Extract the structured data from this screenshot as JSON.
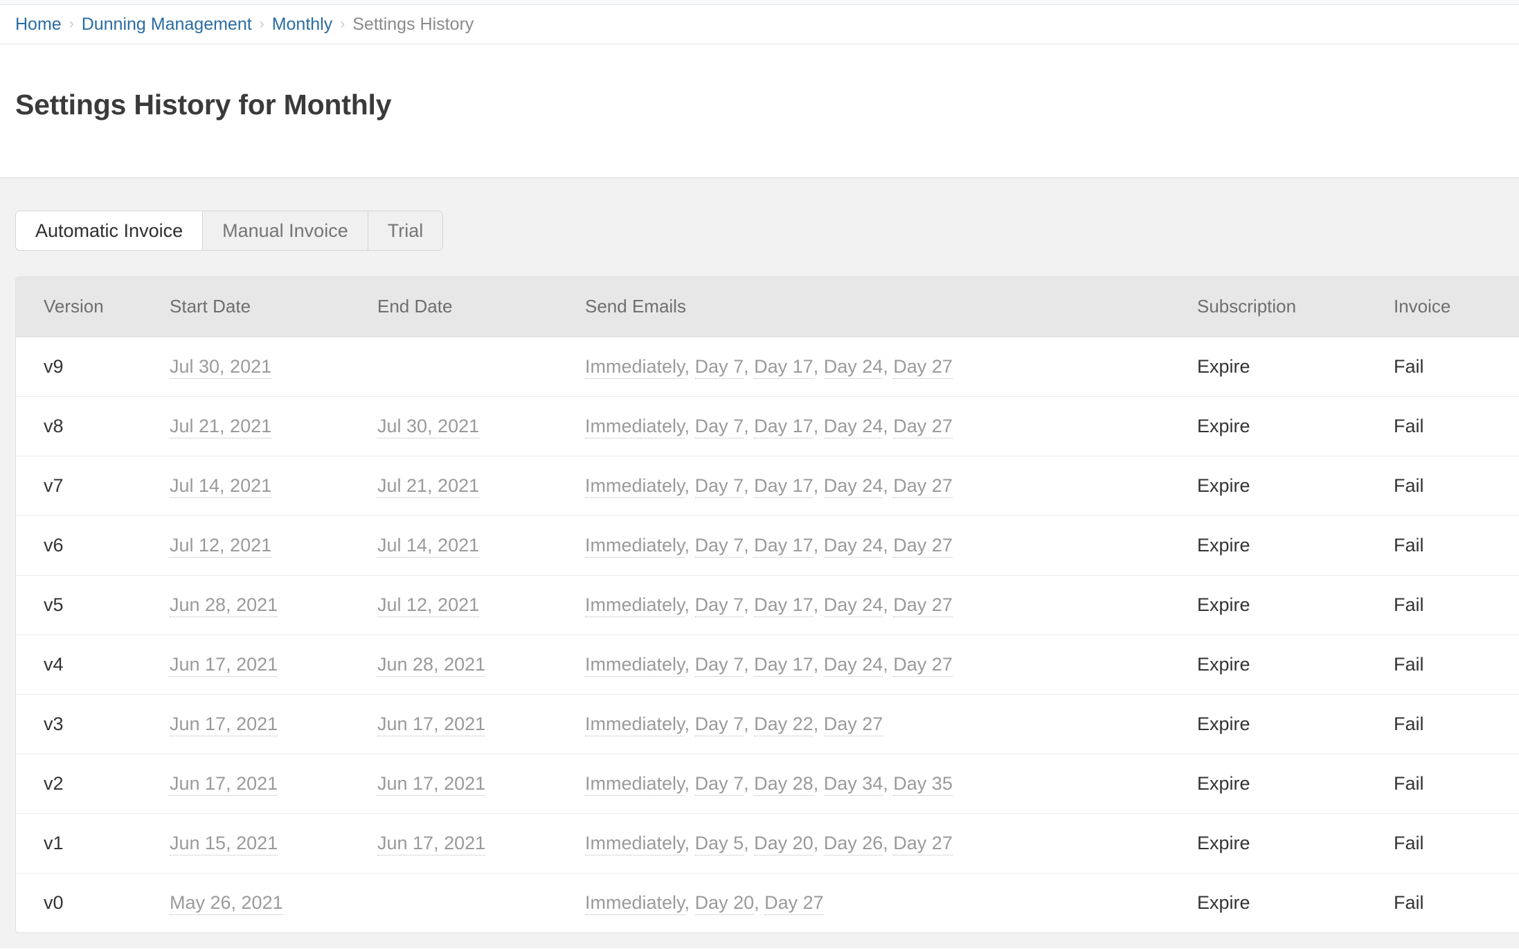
{
  "breadcrumb": {
    "separator": "›",
    "items": [
      {
        "label": "Home",
        "current": false
      },
      {
        "label": "Dunning Management",
        "current": false
      },
      {
        "label": "Monthly",
        "current": false
      },
      {
        "label": "Settings History",
        "current": true
      }
    ]
  },
  "page": {
    "title": "Settings History for Monthly"
  },
  "tabs": [
    {
      "label": "Automatic Invoice",
      "active": true
    },
    {
      "label": "Manual Invoice",
      "active": false
    },
    {
      "label": "Trial",
      "active": false
    }
  ],
  "table": {
    "columns": [
      "Version",
      "Start Date",
      "End Date",
      "Send Emails",
      "Subscription",
      "Invoice"
    ],
    "rows": [
      {
        "version": "v9",
        "start_date": "Jul 30, 2021",
        "end_date": "",
        "send_emails": [
          "Immediately",
          "Day 7",
          "Day 17",
          "Day 24",
          "Day 27"
        ],
        "subscription": "Expire",
        "invoice": "Fail"
      },
      {
        "version": "v8",
        "start_date": "Jul 21, 2021",
        "end_date": "Jul 30, 2021",
        "send_emails": [
          "Immediately",
          "Day 7",
          "Day 17",
          "Day 24",
          "Day 27"
        ],
        "subscription": "Expire",
        "invoice": "Fail"
      },
      {
        "version": "v7",
        "start_date": "Jul 14, 2021",
        "end_date": "Jul 21, 2021",
        "send_emails": [
          "Immediately",
          "Day 7",
          "Day 17",
          "Day 24",
          "Day 27"
        ],
        "subscription": "Expire",
        "invoice": "Fail"
      },
      {
        "version": "v6",
        "start_date": "Jul 12, 2021",
        "end_date": "Jul 14, 2021",
        "send_emails": [
          "Immediately",
          "Day 7",
          "Day 17",
          "Day 24",
          "Day 27"
        ],
        "subscription": "Expire",
        "invoice": "Fail"
      },
      {
        "version": "v5",
        "start_date": "Jun 28, 2021",
        "end_date": "Jul 12, 2021",
        "send_emails": [
          "Immediately",
          "Day 7",
          "Day 17",
          "Day 24",
          "Day 27"
        ],
        "subscription": "Expire",
        "invoice": "Fail"
      },
      {
        "version": "v4",
        "start_date": "Jun 17, 2021",
        "end_date": "Jun 28, 2021",
        "send_emails": [
          "Immediately",
          "Day 7",
          "Day 17",
          "Day 24",
          "Day 27"
        ],
        "subscription": "Expire",
        "invoice": "Fail"
      },
      {
        "version": "v3",
        "start_date": "Jun 17, 2021",
        "end_date": "Jun 17, 2021",
        "send_emails": [
          "Immediately",
          "Day 7",
          "Day 22",
          "Day 27"
        ],
        "subscription": "Expire",
        "invoice": "Fail"
      },
      {
        "version": "v2",
        "start_date": "Jun 17, 2021",
        "end_date": "Jun 17, 2021",
        "send_emails": [
          "Immediately",
          "Day 7",
          "Day 28",
          "Day 34",
          "Day 35"
        ],
        "subscription": "Expire",
        "invoice": "Fail"
      },
      {
        "version": "v1",
        "start_date": "Jun 15, 2021",
        "end_date": "Jun 17, 2021",
        "send_emails": [
          "Immediately",
          "Day 5",
          "Day 20",
          "Day 26",
          "Day 27"
        ],
        "subscription": "Expire",
        "invoice": "Fail"
      },
      {
        "version": "v0",
        "start_date": "May 26, 2021",
        "end_date": "",
        "send_emails": [
          "Immediately",
          "Day 20",
          "Day 27"
        ],
        "subscription": "Expire",
        "invoice": "Fail"
      }
    ]
  },
  "colors": {
    "link": "#2b6ca3",
    "muted_text": "#9a9a9a",
    "page_bg": "#f2f2f2",
    "table_header_bg": "#e7e7e7"
  }
}
